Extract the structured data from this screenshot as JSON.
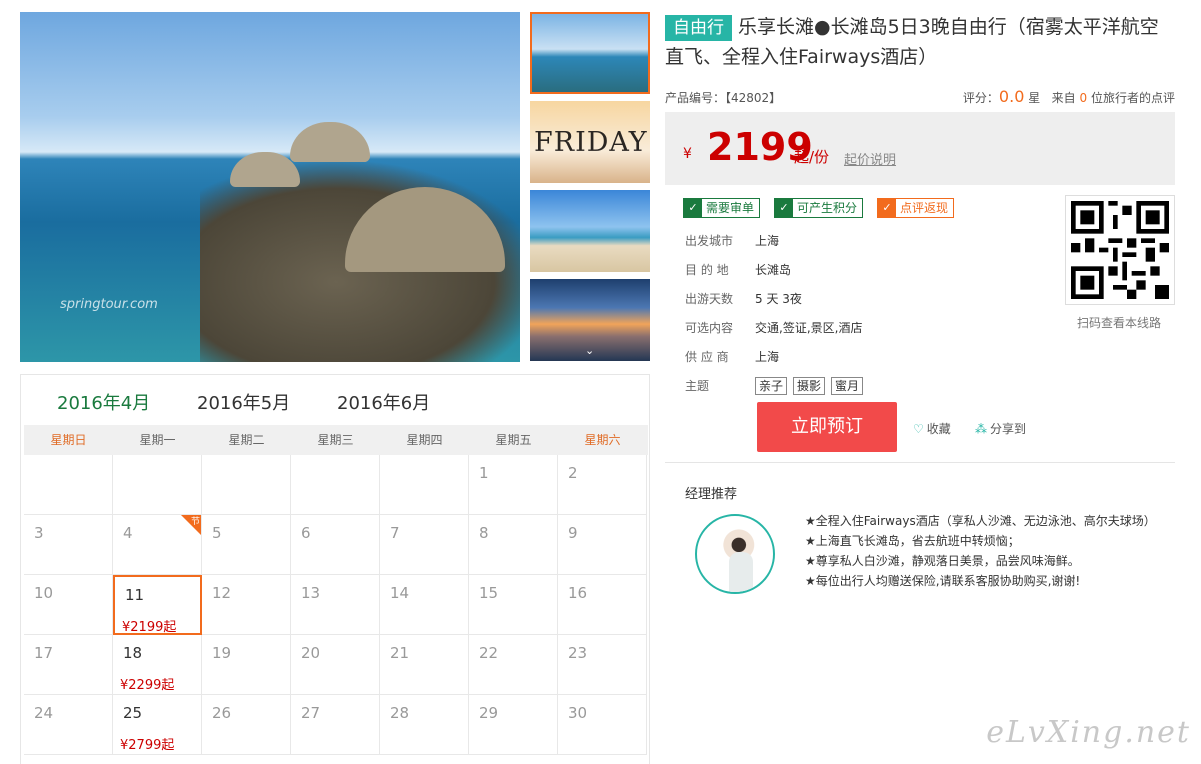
{
  "gallery": {
    "main_watermark": "springtour.com",
    "thumbnail_text": "FRIDAY"
  },
  "calendar": {
    "tabs": [
      "2016年4月",
      "2016年5月",
      "2016年6月"
    ],
    "weekdays": [
      "星期日",
      "星期一",
      "星期二",
      "星期三",
      "星期四",
      "星期五",
      "星期六"
    ],
    "holiday_badge": "节",
    "cells": [
      {
        "d": "",
        "p": ""
      },
      {
        "d": "",
        "p": ""
      },
      {
        "d": "",
        "p": ""
      },
      {
        "d": "",
        "p": ""
      },
      {
        "d": "",
        "p": ""
      },
      {
        "d": "1",
        "p": ""
      },
      {
        "d": "2",
        "p": ""
      },
      {
        "d": "3",
        "p": ""
      },
      {
        "d": "4",
        "p": "",
        "badge": true
      },
      {
        "d": "5",
        "p": ""
      },
      {
        "d": "6",
        "p": ""
      },
      {
        "d": "7",
        "p": ""
      },
      {
        "d": "8",
        "p": ""
      },
      {
        "d": "9",
        "p": ""
      },
      {
        "d": "10",
        "p": ""
      },
      {
        "d": "11",
        "p": "¥2199起",
        "sel": true
      },
      {
        "d": "12",
        "p": ""
      },
      {
        "d": "13",
        "p": ""
      },
      {
        "d": "14",
        "p": ""
      },
      {
        "d": "15",
        "p": ""
      },
      {
        "d": "16",
        "p": ""
      },
      {
        "d": "17",
        "p": ""
      },
      {
        "d": "18",
        "p": "¥2299起"
      },
      {
        "d": "19",
        "p": ""
      },
      {
        "d": "20",
        "p": ""
      },
      {
        "d": "21",
        "p": ""
      },
      {
        "d": "22",
        "p": ""
      },
      {
        "d": "23",
        "p": ""
      },
      {
        "d": "24",
        "p": ""
      },
      {
        "d": "25",
        "p": "¥2799起"
      },
      {
        "d": "26",
        "p": ""
      },
      {
        "d": "27",
        "p": ""
      },
      {
        "d": "28",
        "p": ""
      },
      {
        "d": "29",
        "p": ""
      },
      {
        "d": "30",
        "p": ""
      }
    ]
  },
  "product": {
    "tag": "自由行",
    "title": "乐享长滩●长滩岛5日3晚自由行（宿雾太平洋航空直飞、全程入住Fairways酒店）",
    "code_label": "产品编号：【42802】",
    "rating_label": "评分：",
    "rating_value": "0.0",
    "rating_unit": "星",
    "reviews_prefix": "来自",
    "reviews_count": "0",
    "reviews_suffix": "位旅行者的点评",
    "price_symbol": "¥",
    "price": "2199",
    "price_unit": "起/份",
    "price_explain": "起价说明",
    "flags": [
      "需要审单",
      "可产生积分",
      "点评返现"
    ],
    "attrs": [
      {
        "k": "出发城市",
        "v": "上海"
      },
      {
        "k": "目 的 地",
        "v": "长滩岛"
      },
      {
        "k": "出游天数",
        "v": "5 天 3夜"
      },
      {
        "k": "可选内容",
        "v": "交通,签证,景区,酒店"
      },
      {
        "k": "供 应 商",
        "v": "上海"
      }
    ],
    "theme_label": "主题",
    "themes": [
      "亲子",
      "摄影",
      "蜜月"
    ],
    "qr_caption": "扫码查看本线路",
    "book_label": "立即预订",
    "fav_label": "收藏",
    "share_label": "分享到",
    "manager_title": "经理推荐",
    "manager_lines": [
      "★全程入住Fairways酒店（享私人沙滩、无边泳池、高尔夫球场）",
      "★上海直飞长滩岛，省去航班中转烦恼；",
      "★尊享私人白沙滩，静观落日美景，品尝风味海鲜。",
      "★每位出行人均赠送保险,请联系客服协助购买,谢谢!"
    ]
  },
  "site_watermark": "eLvXing.net",
  "colors": {
    "accent_green": "#1a7a3e",
    "teal": "#27b5a6",
    "orange": "#f26b1d",
    "price_red": "#cc0000",
    "book_button": "#f24a4a"
  }
}
